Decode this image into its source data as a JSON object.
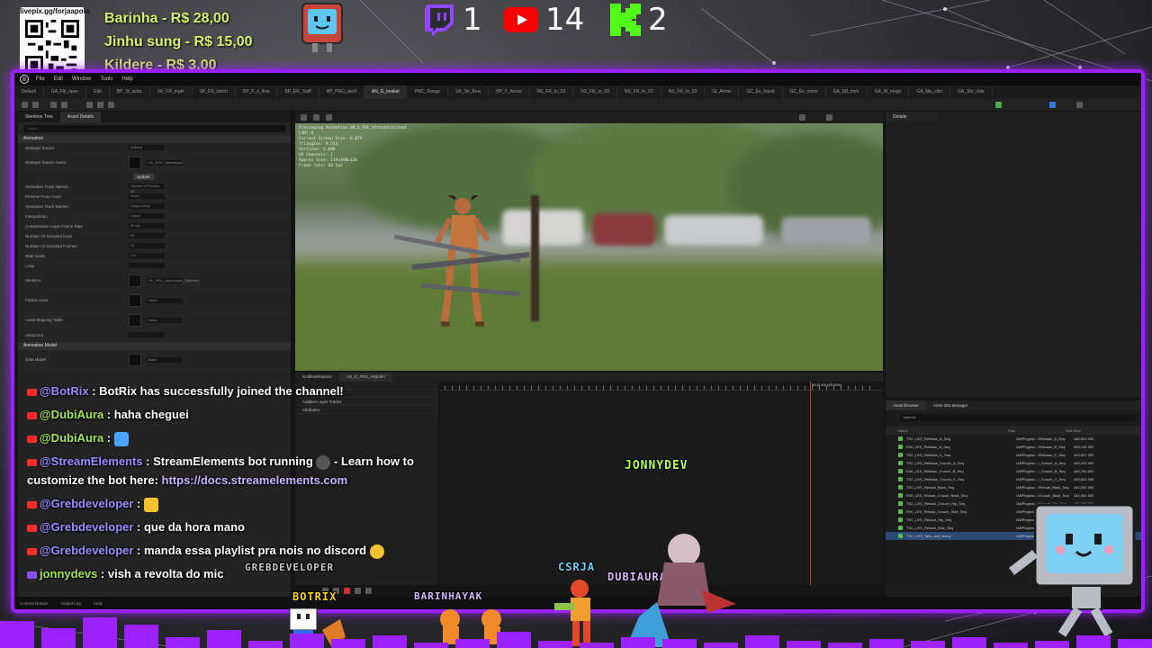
{
  "overlay": {
    "qr_url": "livepix.gg/forjaapolo",
    "donations": [
      {
        "text": "Barinha - R$ 28,00"
      },
      {
        "text": "Jinhu sung - R$ 15,00"
      },
      {
        "text": "Kildere - R$ 3,00"
      }
    ],
    "social": {
      "twitch_count": "1",
      "youtube_count": "14",
      "kick_count": "2"
    },
    "colors": {
      "frame": "#9b22ff",
      "donation": "#d3f06a",
      "twitch": "#9146ff",
      "youtube": "#ff0000",
      "kick": "#53fc18"
    }
  },
  "editor": {
    "menu": [
      "File",
      "Edit",
      "Window",
      "Tools",
      "Help"
    ],
    "tabs": [
      "Default",
      "GA_Fiji_open",
      "Edit",
      "BP_SI_actor",
      "SK_FR_mgkt",
      "SK_FR_lotron",
      "BP_F_n_llow",
      "BP_ER_Staff",
      "BP_PRG_skell",
      "AN_G_lmskel",
      "PMC_Range",
      "SK_Sh_Bow",
      "BP_F_Arrow",
      "NS_FR_to_03",
      "NS_FR_to_03",
      "NS_FR_to_03",
      "NS_FR_to_03",
      "GI_Arrow",
      "GC_Ex_lnand",
      "GC_Ex_cmnn",
      "GA_SB_lmnr",
      "GA_M_mogn",
      "GA_Me_cilm",
      "GA_Shr_clde"
    ],
    "active_tab_index": 9,
    "left_panel": {
      "tabs": [
        "Skeleton Tree",
        "Asset Details"
      ],
      "search_placeholder": "Search",
      "sections": [
        {
          "title": "Animation",
          "rows": [
            {
              "label": "Retarget Source",
              "value": "Default"
            },
            {
              "label": "Retarget Source Asset",
              "value": "SK_PRG_Mannequin"
            },
            {
              "label": "Animation Track Names",
              "value": "Number of Tracks: 92"
            },
            {
              "label": "Preview Pose Asset",
              "value": "None"
            },
            {
              "label": "Animation Track Names",
              "value": "Empty Array"
            },
            {
              "label": "Interpolation",
              "value": "Linear"
            },
            {
              "label": "Compression Layer Frame Rate",
              "value": "30 fps"
            },
            {
              "label": "Number Of Sampled Keys",
              "value": "52"
            },
            {
              "label": "Number Of Sampled Frames",
              "value": "51"
            },
            {
              "label": "Rate Scale",
              "value": "1.0"
            },
            {
              "label": "Loop",
              "value": ""
            },
            {
              "label": "Skeleton",
              "value": "SK_PRG_Mannequin_Skeleton"
            },
            {
              "label": "Parent Asset",
              "value": "None"
            },
            {
              "label": "Asset Mapping Table",
              "value": "None"
            },
            {
              "label": "Advanced",
              "value": ""
            }
          ]
        },
        {
          "title": "Animation Model",
          "rows": [
            {
              "label": "Data Model",
              "value": "Bone"
            }
          ]
        }
      ],
      "update_label": "Update"
    },
    "viewport": {
      "stats": [
        "Previewing Animation AN_G_FBC_AttackFinished",
        "LOD: 0",
        "Current Screen Size: 0.879",
        "Triangles: 9,514",
        "Vertices: 6,090",
        "UV Channels: 1",
        "Approx Size: 119x190x120",
        "Frame rate: 60 fps"
      ]
    },
    "timeline": {
      "tabs": [
        "Notifies/Replace",
        "AN_G_FRG_AttackFi"
      ],
      "rows": [
        "",
        "Curves",
        "Additive Layer Tracks",
        "Attributes"
      ],
      "playhead_label": "83 (0.83) (83.00%)"
    },
    "details": {
      "tab": "Details"
    },
    "assets": {
      "tabs": [
        "Asset Browser",
        "Anim Slot Manager"
      ],
      "search_value": "seek kil",
      "columns": [
        "Name",
        "Path",
        "Disk Size"
      ],
      "rows": [
        {
          "name": "TSC_LES_Release_A_Seq",
          "path": "/All/Plugins/.../Release_A_Seq",
          "size": "450,000 KiB"
        },
        {
          "name": "FAK_LES_Release_B_Seq",
          "path": "/All/Plugins/.../Release_B_Seq",
          "size": "450,135 KiB"
        },
        {
          "name": "TSC_LES_Release_C_Seq",
          "path": "/All/Plugins/.../Release_C_Seq",
          "size": "440,907 KiB"
        },
        {
          "name": "TSC_LES_Release_Crouch_A_Seq",
          "path": "/All/Plugins/.../_Crouch_A_Seq",
          "size": "440,470 KiB"
        },
        {
          "name": "FAK_LES_Release_Crouch_B_Seq",
          "path": "/All/Plugins/.../_Crouch_B_Seq",
          "size": "440,700 KiB"
        },
        {
          "name": "TSC_LES_Release_Crouch_C_Seq",
          "path": "/All/Plugins/.../_Crouch_C_Seq",
          "size": "440,810 KiB"
        },
        {
          "name": "TSC_LES_Reload_Back_Seq",
          "path": "/All/Plugins/.../Reload_Back_Seq",
          "size": "441,000 KiB"
        },
        {
          "name": "FAK_LES_Reload_Crouch_Back_Seq",
          "path": "/All/Plugins/.../Crouch_Back_Seq",
          "size": "441,000 KiB"
        },
        {
          "name": "TSC_LES_Reload_Crouch_Hip_Seq",
          "path": "/All/Plugins/.../Crouch_Hip_Seq",
          "size": "441,000 KiB"
        },
        {
          "name": "FAK_LES_Reload_Crouch_Side_Seq",
          "path": "/All/Plugins/.../Crouch_Side_Seq",
          "size": "441,000 KiB"
        },
        {
          "name": "TSC_LES_Reload_Hip_Seq",
          "path": "/All/Plugins/.../Reload_Hip_Seq",
          "size": "441,000 KiB"
        },
        {
          "name": "TSC_LES_Reload_Side_Seq",
          "path": "/All/Plugins/.../Reload_Side_Seq",
          "size": "441,000 KiB"
        },
        {
          "name": "TSC_LES_Take_and_ready",
          "path": "/All/Plugins/.../Take_and_ready",
          "size": "441,000 KiB"
        }
      ],
      "selected_index": 12
    },
    "statusbar": [
      "Content Drawer",
      "Output Log",
      "Cmd"
    ]
  },
  "chat": [
    {
      "user": "@BotRix",
      "message": " : BotRix has successfully joined the channel!"
    },
    {
      "user": "@DubiAura",
      "message": " : haha cheguei"
    },
    {
      "user": "@DubiAura",
      "message": " :"
    },
    {
      "user": "@StreamElements",
      "message": " : StreamElements bot running",
      "message2": " - Learn how to customize the bot here: ",
      "link": "https://docs.streamelements.com"
    },
    {
      "user": "@Grebdeveloper",
      "message": " :"
    },
    {
      "user": "@Grebdeveloper",
      "message": " : que da hora mano"
    },
    {
      "user": "@Grebdeveloper",
      "message": " : manda essa playlist pra nois no discord"
    },
    {
      "user": "jonnydevs",
      "message": " : vish a revolta do mic"
    }
  ],
  "sprites": {
    "grebdeveloper": "GREBDEVELOPER",
    "botrix": "BOTRIX",
    "barinhayak": "BARINHAYAK",
    "csrja": "CSRJA",
    "dubiaura": "DUBIAURA",
    "jonnydev": "JONNYDEV"
  }
}
